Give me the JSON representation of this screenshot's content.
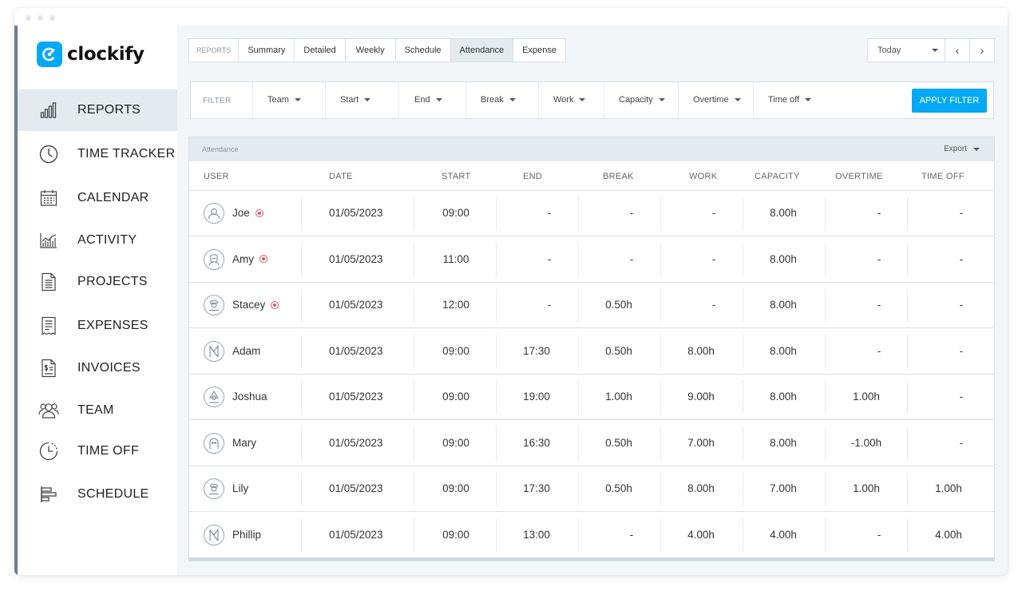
{
  "app": {
    "logo_text": "clockify"
  },
  "sidebar": {
    "items": [
      {
        "label": "REPORTS",
        "icon": "bar-chart-icon",
        "active": true
      },
      {
        "label": "TIME TRACKER",
        "icon": "clock-icon",
        "active": false
      },
      {
        "label": "CALENDAR",
        "icon": "calendar-icon",
        "active": false
      },
      {
        "label": "ACTIVITY",
        "icon": "activity-chart-icon",
        "active": false
      },
      {
        "label": "PROJECTS",
        "icon": "document-icon",
        "active": false
      },
      {
        "label": "EXPENSES",
        "icon": "receipt-icon",
        "active": false
      },
      {
        "label": "INVOICES",
        "icon": "invoice-icon",
        "active": false
      },
      {
        "label": "TEAM",
        "icon": "team-icon",
        "active": false
      },
      {
        "label": "TIME OFF",
        "icon": "time-off-icon",
        "active": false
      },
      {
        "label": "SCHEDULE",
        "icon": "schedule-icon",
        "active": false
      }
    ]
  },
  "tabs": {
    "prefix": "REPORTS",
    "items": [
      "Summary",
      "Detailed",
      "Weekly",
      "Schedule",
      "Attendance",
      "Expense"
    ],
    "active": "Attendance"
  },
  "date_range": {
    "value": "Today",
    "prev": "‹",
    "next": "›"
  },
  "filter": {
    "label": "FILTER",
    "items": [
      "Team",
      "Start",
      "End",
      "Break",
      "Work",
      "Capacity",
      "Overtime",
      "Time off"
    ],
    "apply_label": "APPLY FILTER"
  },
  "report": {
    "title": "Attendance",
    "export_label": "Export",
    "columns": [
      "USER",
      "DATE",
      "START",
      "END",
      "BREAK",
      "WORK",
      "CAPACITY",
      "OVERTIME",
      "TIME OFF"
    ],
    "rows": [
      {
        "user": "Joe",
        "recording": true,
        "date": "01/05/2023",
        "start": "09:00",
        "end": "-",
        "break": "-",
        "work": "-",
        "capacity": "8.00h",
        "overtime": "-",
        "time_off": "-"
      },
      {
        "user": "Amy",
        "recording": true,
        "date": "01/05/2023",
        "start": "11:00",
        "end": "-",
        "break": "-",
        "work": "-",
        "capacity": "8.00h",
        "overtime": "-",
        "time_off": "-"
      },
      {
        "user": "Stacey",
        "recording": true,
        "date": "01/05/2023",
        "start": "12:00",
        "end": "-",
        "break": "0.50h",
        "work": "-",
        "capacity": "8.00h",
        "overtime": "-",
        "time_off": "-"
      },
      {
        "user": "Adam",
        "recording": false,
        "date": "01/05/2023",
        "start": "09:00",
        "end": "17:30",
        "break": "0.50h",
        "work": "8.00h",
        "capacity": "8.00h",
        "overtime": "-",
        "time_off": "-"
      },
      {
        "user": "Joshua",
        "recording": false,
        "date": "01/05/2023",
        "start": "09:00",
        "end": "19:00",
        "break": "1.00h",
        "work": "9.00h",
        "capacity": "8.00h",
        "overtime": "1.00h",
        "time_off": "-"
      },
      {
        "user": "Mary",
        "recording": false,
        "date": "01/05/2023",
        "start": "09:00",
        "end": "16:30",
        "break": "0.50h",
        "work": "7.00h",
        "capacity": "8.00h",
        "overtime": "-1.00h",
        "time_off": "-"
      },
      {
        "user": "Lily",
        "recording": false,
        "date": "01/05/2023",
        "start": "09:00",
        "end": "17:30",
        "break": "0.50h",
        "work": "8.00h",
        "capacity": "7.00h",
        "overtime": "1.00h",
        "time_off": "1.00h"
      },
      {
        "user": "Phillip",
        "recording": false,
        "date": "01/05/2023",
        "start": "09:00",
        "end": "13:00",
        "break": "-",
        "work": "4.00h",
        "capacity": "4.00h",
        "overtime": "-",
        "time_off": "4.00h"
      }
    ]
  },
  "colors": {
    "accent": "#03a9f4",
    "active_bg": "#e4eaee",
    "recording": "#e0545d"
  }
}
